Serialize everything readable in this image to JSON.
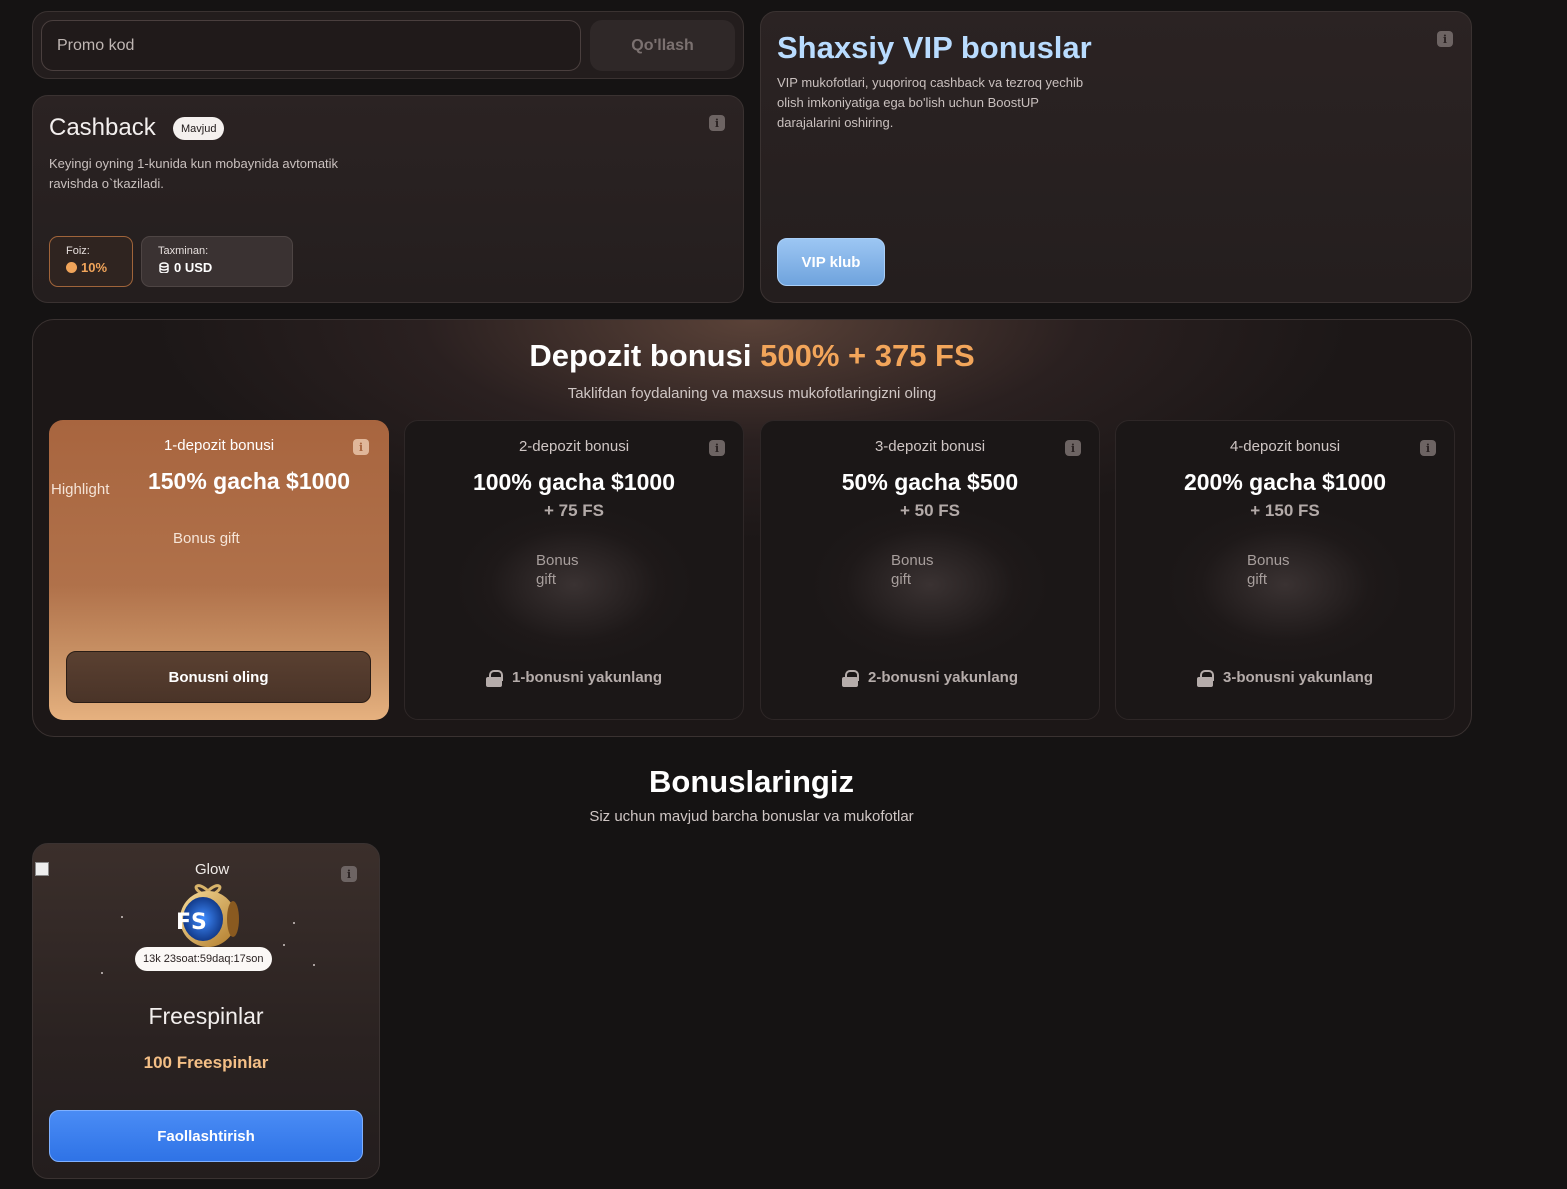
{
  "promo": {
    "placeholder": "Promo kod",
    "apply_label": "Qo'llash"
  },
  "cashback": {
    "title": "Cashback",
    "badge": "Mavjud",
    "description": "Keyingi oyning 1-kunida kun mobaynida avtomatik ravishda o`tkaziladi.",
    "percent_label": "Foiz:",
    "percent_value": "10%",
    "estimate_label": "Taxminan:",
    "estimate_value": "0 USD",
    "info_icon": "info-icon"
  },
  "vip": {
    "title": "Shaxsiy VIP bonuslar",
    "description": "VIP mukofotlari, yuqoriroq cashback va tezroq yechib olish imkoniyatiga ega bo'lish uchun BoostUP darajalarini oshiring.",
    "button_label": "VIP klub"
  },
  "deposit": {
    "title_main": "Depozit bonusi",
    "title_accent": "500% + 375 FS",
    "subtitle": "Taklifdan foydalaning va maxsus mukofotlaringizni oling",
    "cards": [
      {
        "heading": "1-depozit bonusi",
        "highlight_alt": "Highlight",
        "main": "150% gacha $1000",
        "fs": "",
        "image_alt": "Bonus gift",
        "button_label": "Bonusni oling"
      },
      {
        "heading": "2-depozit bonusi",
        "main": "100% gacha $1000",
        "fs": "+ 75 FS",
        "image_alt_1": "Bonus",
        "image_alt_2": "gift",
        "lock_label": "1-bonusni yakunlang"
      },
      {
        "heading": "3-depozit bonusi",
        "main": "50% gacha $500",
        "fs": "+ 50 FS",
        "image_alt_1": "Bonus",
        "image_alt_2": "gift",
        "lock_label": "2-bonusni yakunlang"
      },
      {
        "heading": "4-depozit bonusi",
        "main": "200% gacha $1000",
        "fs": "+ 150 FS",
        "image_alt_1": "Bonus",
        "image_alt_2": "gift",
        "lock_label": "3-bonusni yakunlang"
      }
    ]
  },
  "bonuses": {
    "title": "Bonuslaringiz",
    "subtitle": "Siz uchun mavjud barcha bonuslar va mukofotlar",
    "card": {
      "glow_alt": "Glow",
      "art_text": "FS",
      "timer": "13k 23soat:59daq:17son",
      "name": "Freespinlar",
      "amount": "100 Freespinlar",
      "button_label": "Faollashtirish"
    }
  },
  "colors": {
    "accent_orange": "#f2a55a",
    "vip_blue": "#b9dcff",
    "button_blue": "#2f73e6"
  }
}
